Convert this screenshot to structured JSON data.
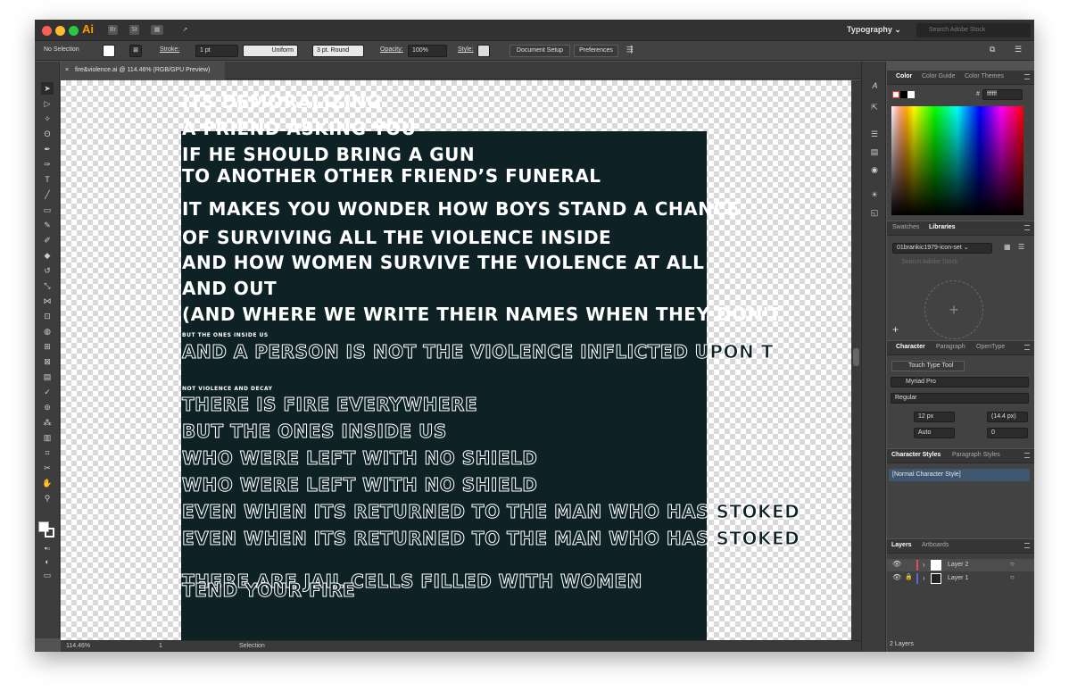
{
  "app": {
    "logo": "Ai",
    "bridge": "Br",
    "stock": "St",
    "workspace": "Typography",
    "search_placeholder": "Search Adobe Stock"
  },
  "control": {
    "selection": "No Selection",
    "stroke_label": "Stroke:",
    "stroke_value": "1 pt",
    "profile": "Uniform",
    "brush": "3 pt. Round",
    "opacity_label": "Opacity:",
    "opacity_value": "100%",
    "style_label": "Style:",
    "doc_setup": "Document Setup",
    "preferences": "Preferences"
  },
  "document": {
    "tab_title": "fire&violence.ai @ 114.46% (RGB/GPU Preview)"
  },
  "poem": [
    {
      "text": "ITS DEMORALIZING",
      "style": "solid"
    },
    {
      "text": "A FRIEND ASKING YOU",
      "style": "solid"
    },
    {
      "text": "IF HE SHOULD BRING A GUN",
      "style": "solid"
    },
    {
      "text": "TO ANOTHER OTHER FRIEND’S FUNERAL",
      "style": "solid"
    },
    {
      "text": " IT MAKES YOU WONDER HOW BOYS STAND A CHANCE",
      "style": "solid"
    },
    {
      "text": "OF SURVIVING ALL THE VIOLENCE INSIDE",
      "style": "solid"
    },
    {
      "text": "AND HOW WOMEN SURVIVE THE VIOLENCE AT ALL",
      "style": "solid"
    },
    {
      "text": "AND OUT",
      "style": "solid"
    },
    {
      "text": "(AND WHERE WE WRITE THEIR NAMES WHEN THEY DON'T",
      "style": "solid"
    },
    {
      "text": "BUT THE ONES INSIDE US",
      "style": "small"
    },
    {
      "text": "AND A PERSON IS NOT THE VIOLENCE INFLICTED UPON T",
      "style": "outline"
    },
    {
      "text": "NOT VIOLENCE AND DECAY",
      "style": "small"
    },
    {
      "text": "THERE IS FIRE EVERYWHERE",
      "style": "outline"
    },
    {
      "text": "BUT THE ONES INSIDE US",
      "style": "outline"
    },
    {
      "text": "WHO WERE LEFT WITH NO SHIELD",
      "style": "outline"
    },
    {
      "text": "WHO WERE LEFT WITH NO SHIELD",
      "style": "outline"
    },
    {
      "text": "EVEN WHEN ITS RETURNED TO THE MAN WHO HAS STOKED",
      "style": "outline"
    },
    {
      "text": "EVEN WHEN ITS RETURNED TO THE MAN WHO HAS STOKED",
      "style": "outline"
    },
    {
      "text": "THERE ARE JAIL CELLS FILLED WITH WOMEN",
      "style": "outline"
    },
    {
      "text": "TEND YOUR FIRE",
      "style": "outline"
    }
  ],
  "status": {
    "zoom": "114.46%",
    "artboard": "1",
    "mode": "Selection"
  },
  "color_panel": {
    "tabs": [
      "Color",
      "Color Guide",
      "Color Themes"
    ],
    "hash": "#",
    "hex": "ffffff"
  },
  "libraries_panel": {
    "tabs": [
      "Swatches",
      "Libraries"
    ],
    "library": "01brankic1979-icon-set",
    "search_placeholder": "Search Adobe Stock"
  },
  "character_panel": {
    "tabs": [
      "Character",
      "Paragraph",
      "OpenType"
    ],
    "touch_type": "Touch Type Tool",
    "font": "Myriad Pro",
    "style": "Regular",
    "size": "12 px",
    "leading": "(14.4 px)",
    "kerning": "Auto",
    "tracking": "0"
  },
  "styles_panel": {
    "tabs": [
      "Character Styles",
      "Paragraph Styles"
    ],
    "item": "[Normal Character Style]"
  },
  "layers_panel": {
    "tabs": [
      "Layers",
      "Artboards"
    ],
    "layers": [
      "Layer 2",
      "Layer 1"
    ],
    "count": "2 Layers"
  },
  "colors": {
    "artboard": "#0e2226",
    "layer2": "#e84d4d",
    "layer1": "#4b6fe0",
    "accent": "#ff9a00"
  }
}
